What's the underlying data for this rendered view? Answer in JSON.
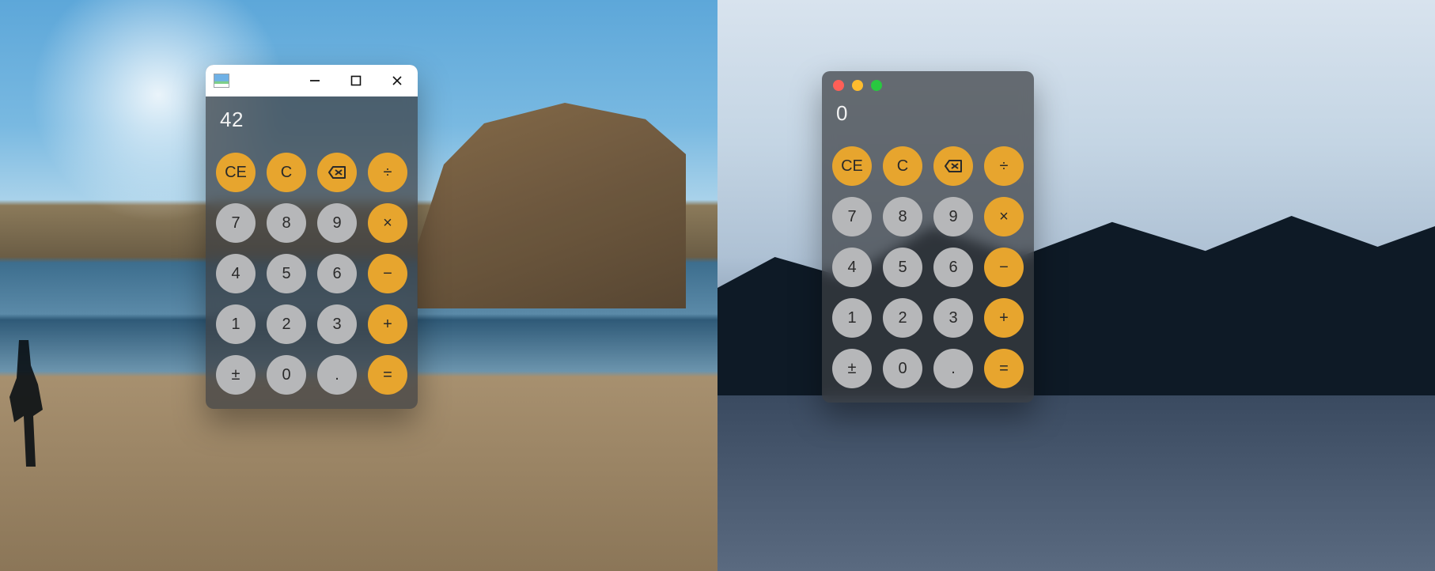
{
  "left": {
    "display": "42",
    "keys": {
      "ce": "CE",
      "c": "C",
      "back": "⌫",
      "div": "÷",
      "n7": "7",
      "n8": "8",
      "n9": "9",
      "mul": "×",
      "n4": "4",
      "n5": "5",
      "n6": "6",
      "sub": "−",
      "n1": "1",
      "n2": "2",
      "n3": "3",
      "add": "+",
      "sign": "±",
      "n0": "0",
      "dot": ".",
      "eq": "="
    }
  },
  "right": {
    "display": "0",
    "keys": {
      "ce": "CE",
      "c": "C",
      "back": "⌫",
      "div": "÷",
      "n7": "7",
      "n8": "8",
      "n9": "9",
      "mul": "×",
      "n4": "4",
      "n5": "5",
      "n6": "6",
      "sub": "−",
      "n1": "1",
      "n2": "2",
      "n3": "3",
      "add": "+",
      "sign": "±",
      "n0": "0",
      "dot": ".",
      "eq": "="
    }
  },
  "colors": {
    "accent": "#e7a52e",
    "key_gray": "#b6b7b9",
    "panel": "rgba(60,62,66,0.72)"
  }
}
